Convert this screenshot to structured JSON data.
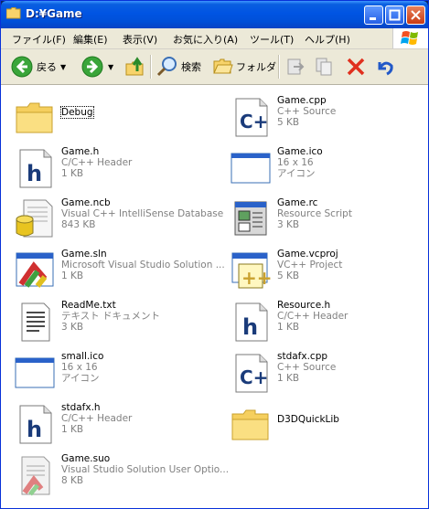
{
  "window": {
    "title": "D:¥Game"
  },
  "menu": {
    "items": [
      "ファイル(F)",
      "編集(E)",
      "表示(V)",
      "お気に入り(A)",
      "ツール(T)",
      "ヘルプ(H)"
    ]
  },
  "toolbar": {
    "back_label": "戻る",
    "search_label": "検索",
    "folders_label": "フォルダ"
  },
  "files": [
    {
      "name": "Debug",
      "type": "",
      "size": "",
      "icon": "folder-icon"
    },
    {
      "name": "Game.cpp",
      "type": "C++ Source",
      "size": "5 KB",
      "icon": "cpp-file-icon"
    },
    {
      "name": "Game.h",
      "type": "C/C++ Header",
      "size": "1 KB",
      "icon": "header-file-icon"
    },
    {
      "name": "Game.ico",
      "type": "16 x 16",
      "size": "アイコン",
      "icon": "ico-file-icon"
    },
    {
      "name": "Game.ncb",
      "type": "Visual C++ IntelliSense Database",
      "size": "843 KB",
      "icon": "ncb-file-icon"
    },
    {
      "name": "Game.rc",
      "type": "Resource Script",
      "size": "3 KB",
      "icon": "rc-file-icon"
    },
    {
      "name": "Game.sln",
      "type": "Microsoft Visual Studio Solution ...",
      "size": "1 KB",
      "icon": "sln-file-icon"
    },
    {
      "name": "Game.vcproj",
      "type": "VC++ Project",
      "size": "5 KB",
      "icon": "vcproj-file-icon"
    },
    {
      "name": "ReadMe.txt",
      "type": "テキスト ドキュメント",
      "size": "3 KB",
      "icon": "text-file-icon"
    },
    {
      "name": "Resource.h",
      "type": "C/C++ Header",
      "size": "1 KB",
      "icon": "header-file-icon"
    },
    {
      "name": "small.ico",
      "type": "16 x 16",
      "size": "アイコン",
      "icon": "ico-file-icon"
    },
    {
      "name": "stdafx.cpp",
      "type": "C++ Source",
      "size": "1 KB",
      "icon": "cpp-file-icon"
    },
    {
      "name": "stdafx.h",
      "type": "C/C++ Header",
      "size": "1 KB",
      "icon": "header-file-icon"
    },
    {
      "name": "D3DQuickLib",
      "type": "",
      "size": "",
      "icon": "folder-icon"
    },
    {
      "name": "Game.suo",
      "type": "Visual Studio Solution User Optio...",
      "size": "8 KB",
      "icon": "suo-file-icon"
    }
  ]
}
